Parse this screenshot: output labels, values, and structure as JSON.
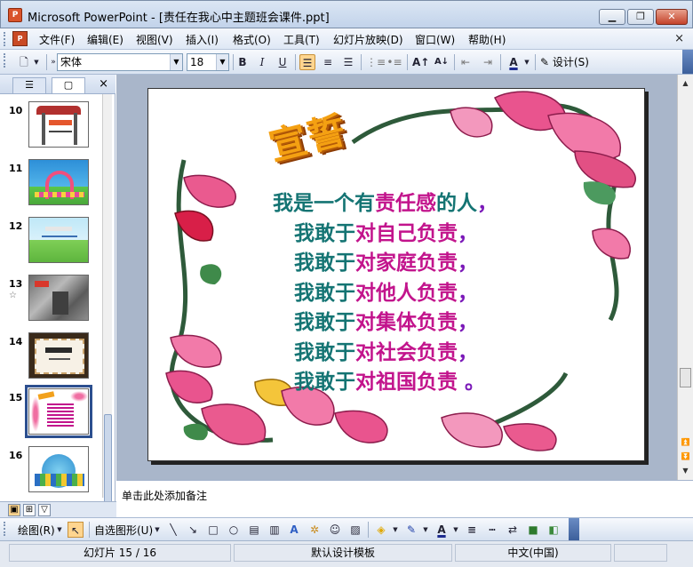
{
  "window": {
    "title": "Microsoft PowerPoint - [责任在我心中主题班会课件.ppt]",
    "minimize": "▁",
    "maximize": "❐",
    "close": "✕"
  },
  "menubar": {
    "items": [
      "文件(F)",
      "编辑(E)",
      "视图(V)",
      "插入(I)",
      "格式(O)",
      "工具(T)",
      "幻灯片放映(D)",
      "窗口(W)",
      "帮助(H)"
    ],
    "close": "×"
  },
  "toolbar": {
    "font_name": "宋体",
    "font_size": "18",
    "bold": "B",
    "italic": "I",
    "underline": "U",
    "design_label": "设计(S)"
  },
  "slides_panel": {
    "tab_outline": "☰",
    "tab_slides": "▢",
    "close": "×",
    "slides": [
      {
        "num": "10",
        "star": ""
      },
      {
        "num": "11",
        "star": ""
      },
      {
        "num": "12",
        "star": ""
      },
      {
        "num": "13",
        "star": "☆"
      },
      {
        "num": "14",
        "star": ""
      },
      {
        "num": "15",
        "star": ""
      },
      {
        "num": "16",
        "star": ""
      }
    ],
    "selected_slide": "15"
  },
  "slide": {
    "title": "宣誓",
    "lines": [
      {
        "a": "我是一个有",
        "b": "责任感",
        "c": "的人",
        "d": "，"
      },
      {
        "a": "我敢于",
        "b": "对自己负责",
        "c": "",
        "d": "，"
      },
      {
        "a": "我敢于",
        "b": "对家庭负责",
        "c": "",
        "d": "，"
      },
      {
        "a": "我敢于",
        "b": "对他人负责",
        "c": "",
        "d": "，"
      },
      {
        "a": "我敢于",
        "b": "对集体负责",
        "c": "",
        "d": "，"
      },
      {
        "a": "我敢于",
        "b": "对社会负责",
        "c": "",
        "d": "，"
      },
      {
        "a": "我敢于",
        "b": "对祖国负责",
        "c": "",
        "d": " 。"
      }
    ]
  },
  "notes": {
    "placeholder": "单击此处添加备注"
  },
  "drawbar": {
    "draw_label": "绘图(R)",
    "autoshapes_label": "自选图形(U)"
  },
  "statusbar": {
    "slide_info": "幻灯片 15 / 16",
    "template": "默认设计模板",
    "language": "中文(中国)"
  },
  "colors": {
    "oath_teal": "#147473",
    "oath_pink": "#c2148c",
    "title_orange": "#f4a012"
  }
}
